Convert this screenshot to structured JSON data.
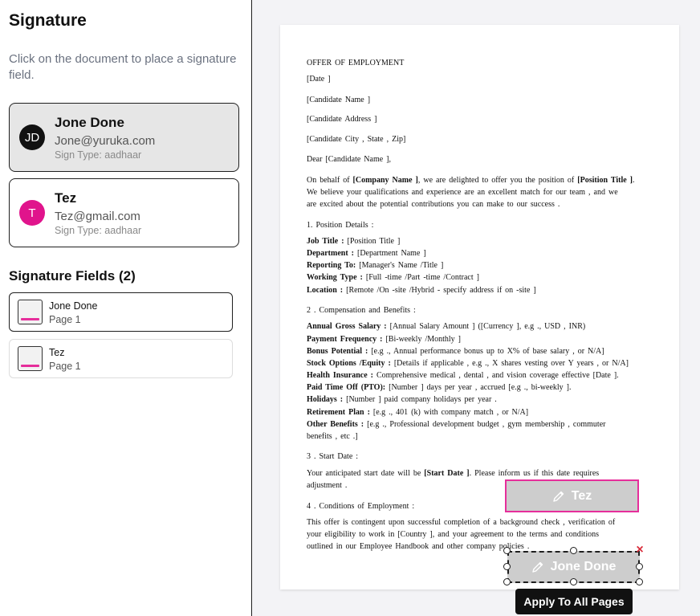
{
  "sidebar": {
    "title": "Signature",
    "hint": "Click on the document to place a signature field.",
    "signers": [
      {
        "initials": "JD",
        "name": "Jone Done",
        "email": "Jone@yuruka.com",
        "sign_type": "Sign Type: aadhaar",
        "avatar_color": "#111111"
      },
      {
        "initials": "T",
        "name": "Tez",
        "email": "Tez@gmail.com",
        "sign_type": "Sign Type: aadhaar",
        "avatar_color": "#e0148c"
      }
    ],
    "fields_title": "Signature Fields (2)",
    "fields": [
      {
        "name": "Jone Done",
        "page": "Page 1"
      },
      {
        "name": "Tez",
        "page": "Page 1"
      }
    ]
  },
  "document": {
    "lines": [
      "OFFER OF EMPLOYMENT",
      "[Date ]",
      "[Candidate Name ]",
      "[Candidate Address ]",
      "[Candidate City , State , Zip]",
      "Dear [Candidate Name ],",
      "intro1",
      "We believe your qualifications and experience are an excellent match for our team , and we",
      "are excited about the potential contributions you can make to our success .",
      "1. Position Details :",
      "job_title",
      "department",
      "reporting",
      "working",
      "location",
      "2 . Compensation and Benefits :",
      "salary",
      "frequency",
      "bonus",
      "stock",
      "health",
      "pto",
      "holidays",
      "retirement",
      "other",
      "benefits , etc .]",
      "3 . Start Date :",
      "start",
      "adjustment .",
      "4 . Conditions of Employment :",
      "This offer is contingent upon successful completion of a background check , verification of",
      "your eligibility to work in [Country ], and your agreement to the terms and conditions",
      "outlined in our Employee Handbook and other company policies ."
    ],
    "rich": {
      "intro1": {
        "a": "On behalf of ",
        "b": "[Company Name ]",
        "c": ", we are delighted to offer you the position of ",
        "d": "[Position Title ]",
        "e": "."
      },
      "job_title": {
        "k": "Job Title :",
        "v": " [Position Title ]"
      },
      "department": {
        "k": "Department :",
        "v": " [Department Name ]"
      },
      "reporting": {
        "k": "Reporting To:",
        "v": " [Manager's Name /Title ]"
      },
      "working": {
        "k": "Working Type :",
        "v": " [Full -time /Part -time /Contract ]"
      },
      "location": {
        "k": "Location :",
        "v": " [Remote /On -site /Hybrid - specify address if on -site ]"
      },
      "salary": {
        "k": "Annual Gross Salary :",
        "v": " [Annual Salary Amount ] ([Currency ], e.g ., USD , INR)"
      },
      "frequency": {
        "k": "Payment Frequency :",
        "v": " [Bi-weekly /Monthly ]"
      },
      "bonus": {
        "k": "Bonus Potential :",
        "v": " [e.g ., Annual performance bonus up to X% of base salary , or N/A]"
      },
      "stock": {
        "k": "Stock Options /Equity :",
        "v": " [Details if applicable , e.g ., X shares vesting over Y years , or N/A]"
      },
      "health": {
        "k": "Health Insurance :",
        "v": " Comprehensive medical , dental , and vision coverage effective [Date ]."
      },
      "pto": {
        "k": "Paid Time Off (PTO):",
        "v": " [Number ] days per year , accrued [e.g ., bi-weekly ]."
      },
      "holidays": {
        "k": "Holidays :",
        "v": " [Number ] paid company holidays per year ."
      },
      "retirement": {
        "k": "Retirement Plan :",
        "v": " [e.g ., 401 (k) with company match , or N/A]"
      },
      "other": {
        "k": "Other Benefits :",
        "v": " [e.g ., Professional development budget , gym membership , commuter"
      },
      "start": {
        "a": "Your anticipated start date will be ",
        "b": "[Start Date ]",
        "c": ". Please inform us if this date requires"
      }
    }
  },
  "signature_boxes": {
    "tez_label": "Tez",
    "jone_label": "Jone Done",
    "close_symbol": "×"
  },
  "apply_button": "Apply To All Pages",
  "colors": {
    "accent_pink": "#e62e9b",
    "dark": "#111111",
    "delete_red": "#d92d3b"
  }
}
